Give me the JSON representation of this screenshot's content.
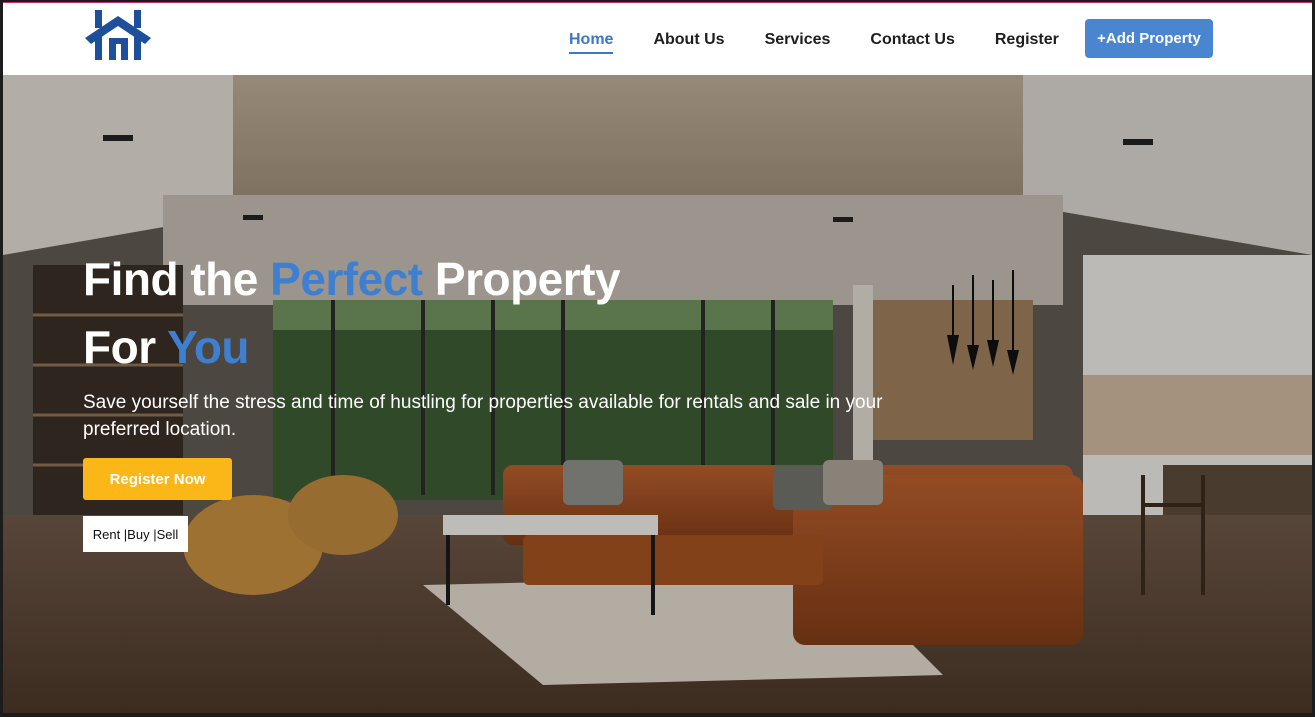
{
  "nav": {
    "logo_icon": "house-logo-icon",
    "links": [
      {
        "label": "Home",
        "active": true
      },
      {
        "label": "About Us",
        "active": false
      },
      {
        "label": "Services",
        "active": false
      },
      {
        "label": "Contact Us",
        "active": false
      },
      {
        "label": "Register",
        "active": false
      }
    ],
    "add_property_label": "+Add Property"
  },
  "hero": {
    "headline_part1": "Find the ",
    "headline_accent1": "Perfect",
    "headline_part2": " Property",
    "headline_part3": "For ",
    "headline_accent2": "You",
    "subtext": "Save yourself the stress and time of hustling for properties available for rentals and sale in your preferred location.",
    "register_now_label": "Register Now",
    "tagline": "Rent |Buy |Sell"
  },
  "colors": {
    "accent": "#3d78c3",
    "button_blue": "#4a86cf",
    "button_yellow": "#fbb718",
    "logo": "#1d4f9a"
  }
}
